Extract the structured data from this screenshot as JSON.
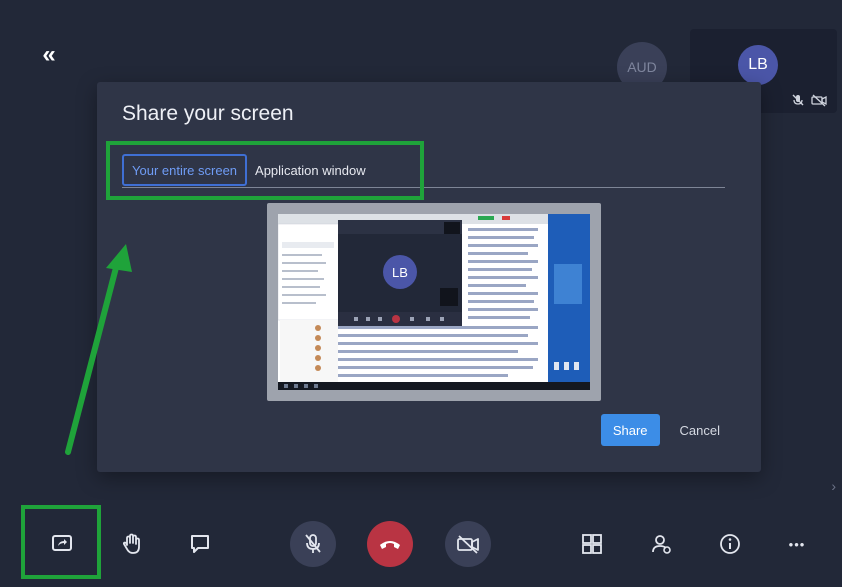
{
  "header": {
    "collapse_icon": "double-chevron-left-icon",
    "collapse_glyph": "«"
  },
  "participants": {
    "aud_initials": "AUD",
    "self_initials": "LB",
    "self_icons": [
      "mic-off-icon",
      "camera-off-icon"
    ]
  },
  "modal": {
    "title": "Share your screen",
    "tabs": [
      {
        "label": "Your entire screen",
        "active": true
      },
      {
        "label": "Application window",
        "active": false
      }
    ],
    "preview_initials": "LB",
    "share_label": "Share",
    "cancel_label": "Cancel"
  },
  "toolbar": {
    "items": [
      "share-screen-icon",
      "raise-hand-icon",
      "chat-icon",
      "mic-off-icon",
      "end-call-icon",
      "camera-off-icon",
      "grid-view-icon",
      "participants-icon",
      "info-icon",
      "more-icon"
    ],
    "more_glyph": "•••"
  },
  "colors": {
    "background": "#222838",
    "modal": "#2f3547",
    "accent": "#3c8de7",
    "annotation": "#1fa33a",
    "end_call": "#b93443"
  }
}
